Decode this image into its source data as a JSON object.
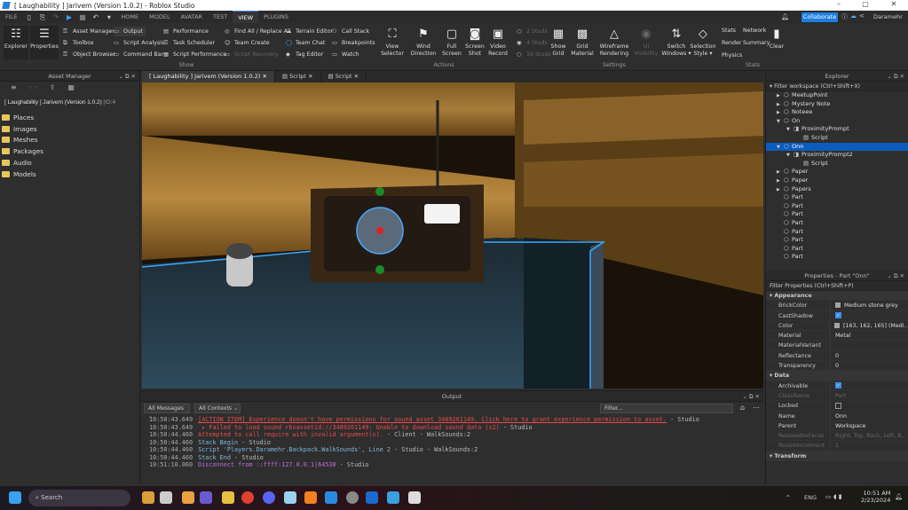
{
  "window": {
    "title": "[ Laughability ] Jarivem (Version 1.0.2) - Roblox Studio",
    "minimize": "–",
    "maximize": "▢",
    "close": "✕"
  },
  "menubar": {
    "file": "FILE",
    "tabs": [
      "HOME",
      "MODEL",
      "AVATAR",
      "TEST",
      "VIEW",
      "PLUGINS"
    ],
    "active": "VIEW",
    "collaborate": "Collaborate",
    "user": "Daramehr"
  },
  "ribbon": {
    "explorer": "Explorer",
    "properties": "Properties",
    "show_col1": [
      "Asset Manager",
      "Toolbox",
      "Object Browser"
    ],
    "show_col2": [
      "Output",
      "Script Analysis",
      "Command Bar"
    ],
    "show_col3": [
      "Performance",
      "Task Scheduler",
      "Script Performance"
    ],
    "show_col4": [
      "Find All / Replace All",
      "Team Create",
      "Script Recovery"
    ],
    "show_col5": [
      "Terrain Editor",
      "Team Chat",
      "Tag Editor"
    ],
    "show_col6": [
      "Call Stack",
      "Breakpoints",
      "Watch"
    ],
    "show_label": "Show",
    "actions": [
      {
        "l1": "View",
        "l2": "Selector"
      },
      {
        "l1": "Wind",
        "l2": "Direction"
      },
      {
        "l1": "Full",
        "l2": "Screen"
      },
      {
        "l1": "Screen",
        "l2": "Shot"
      },
      {
        "l1": "Video",
        "l2": "Record"
      }
    ],
    "actions_label": "Actions",
    "studs": [
      "2 Studs",
      "4 Studs",
      "16 Studs"
    ],
    "settings": [
      {
        "l1": "Show",
        "l2": "Grid"
      },
      {
        "l1": "Grid",
        "l2": "Material"
      },
      {
        "l1": "Wireframe",
        "l2": "Rendering"
      },
      {
        "l1": "UI Visibility",
        "l2": ""
      },
      {
        "l1": "Switch",
        "l2": "Windows ▾"
      },
      {
        "l1": "Selection",
        "l2": "Style ▾"
      }
    ],
    "settings_label": "Settings",
    "stats": [
      "Stats",
      "Network",
      "Render",
      "Summary",
      "Physics"
    ],
    "clear": "Clear",
    "stats_label": "Stats"
  },
  "asset_manager": {
    "title": "Asset Manager",
    "place": "[ Laughability ] Jarivem (Version 1.0.2)",
    "id_prefix": "[ID:4",
    "folders": [
      "Places",
      "Images",
      "Meshes",
      "Packages",
      "Audio",
      "Models"
    ]
  },
  "doc_tabs": [
    "[ Laughability ] Jarivem (Version 1.0.2)",
    "Script",
    "Script"
  ],
  "output": {
    "title": "Output",
    "messages_filter": "All Messages",
    "contexts_filter": "All Contexts",
    "filter_placeholder": "Filter...",
    "lines": [
      {
        "time": "10:50:43.649",
        "text": "[ACTION ITEM] Experience doesn't have permissions for sound asset 3489261149. Click here to grant experience permission to asset.",
        "src": "  -  Studio",
        "color": "#e84a4a"
      },
      {
        "time": "10:50:43.649",
        "text": " ▸ Failed to load sound rbxassetid://3489261149: Unable to download sound data (x2)",
        "src": "  -  Studio",
        "color": "#e84a4a"
      },
      {
        "time": "10:50:44.460",
        "text": "Attempted to call require with invalid argument(s).",
        "src": "  -  Client - WalkSounds:2",
        "color": "#e84a4a"
      },
      {
        "time": "10:50:44.460",
        "text": "Stack Begin",
        "src": "  -  Studio",
        "color": "#7fb6e0"
      },
      {
        "time": "10:50:44.460",
        "text": "Script 'Players.Daramehr.Backpack.WalkSounds', Line 2",
        "src": "  -  Studio - WalkSounds:2",
        "color": "#7fb6e0"
      },
      {
        "time": "10:50:44.460",
        "text": "Stack End",
        "src": "  -  Studio",
        "color": "#7fb6e0"
      },
      {
        "time": "10:51:10.060",
        "text": "Disconnect from ::ffff:127.0.0.1|64530",
        "src": "  -  Studio",
        "color": "#c46be0"
      }
    ]
  },
  "explorer": {
    "title": "Explorer",
    "filter": "Filter workspace (Ctrl+Shift+X)",
    "items": [
      {
        "label": "MeetupPoint",
        "depth": 0,
        "arrow": "▶",
        "icon": "part"
      },
      {
        "label": "Mystery Note",
        "depth": 0,
        "arrow": "▶",
        "icon": "part"
      },
      {
        "label": "Noteee",
        "depth": 0,
        "arrow": "▶",
        "icon": "part"
      },
      {
        "label": "On",
        "depth": 0,
        "arrow": "▼",
        "icon": "part"
      },
      {
        "label": "ProximityPrompt",
        "depth": 1,
        "arrow": "▼",
        "icon": "prompt"
      },
      {
        "label": "Script",
        "depth": 2,
        "arrow": "",
        "icon": "script"
      },
      {
        "label": "Onn",
        "depth": 0,
        "arrow": "▼",
        "icon": "part",
        "selected": true
      },
      {
        "label": "ProximityPrompt2",
        "depth": 1,
        "arrow": "▼",
        "icon": "prompt"
      },
      {
        "label": "Script",
        "depth": 2,
        "arrow": "",
        "icon": "script"
      },
      {
        "label": "Paper",
        "depth": 0,
        "arrow": "▶",
        "icon": "part"
      },
      {
        "label": "Paper",
        "depth": 0,
        "arrow": "▶",
        "icon": "part"
      },
      {
        "label": "Papers",
        "depth": 0,
        "arrow": "▶",
        "icon": "part"
      },
      {
        "label": "Part",
        "depth": 0,
        "arrow": "",
        "icon": "part"
      },
      {
        "label": "Part",
        "depth": 0,
        "arrow": "",
        "icon": "part"
      },
      {
        "label": "Part",
        "depth": 0,
        "arrow": "",
        "icon": "part"
      },
      {
        "label": "Part",
        "depth": 0,
        "arrow": "",
        "icon": "part"
      },
      {
        "label": "Part",
        "depth": 0,
        "arrow": "",
        "icon": "part"
      },
      {
        "label": "Part",
        "depth": 0,
        "arrow": "",
        "icon": "part"
      },
      {
        "label": "Part",
        "depth": 0,
        "arrow": "",
        "icon": "part"
      },
      {
        "label": "Part",
        "depth": 0,
        "arrow": "",
        "icon": "part"
      }
    ]
  },
  "properties": {
    "title": "Properties - Part \"Onn\"",
    "filter": "Filter Properties (Ctrl+Shift+P)",
    "rows": [
      {
        "cat": true,
        "name": "Appearance"
      },
      {
        "name": "BrickColor",
        "value": "Medium stone grey",
        "swatch": true
      },
      {
        "name": "CastShadow",
        "check": true
      },
      {
        "name": "Color",
        "value": "[163, 162, 165] (Medi...",
        "swatch": true
      },
      {
        "name": "Material",
        "value": "Metal"
      },
      {
        "name": "MaterialVariant",
        "value": ""
      },
      {
        "name": "Reflectance",
        "value": "0"
      },
      {
        "name": "Transparency",
        "value": "0"
      },
      {
        "cat": true,
        "name": "Data"
      },
      {
        "name": "Archivable",
        "check": true
      },
      {
        "name": "ClassName",
        "value": "Part",
        "dim": true
      },
      {
        "name": "Locked",
        "check": false
      },
      {
        "name": "Name",
        "value": "Onn"
      },
      {
        "name": "Parent",
        "value": "Workspace"
      },
      {
        "name": "ResizeableFaces",
        "value": "Right, Top, Back, Left, B...",
        "dim": true
      },
      {
        "name": "ResizeIncrement",
        "value": "1",
        "dim": true
      },
      {
        "cat": true,
        "name": "Transform"
      }
    ]
  },
  "taskbar": {
    "search": "Search",
    "lang": "ENG",
    "time": "10:51 AM",
    "date": "2/23/2024"
  },
  "colors": {
    "accent": "#1f7fe0",
    "selection": "#0b5cbd",
    "error": "#e84a4a",
    "info": "#7fb6e0"
  }
}
